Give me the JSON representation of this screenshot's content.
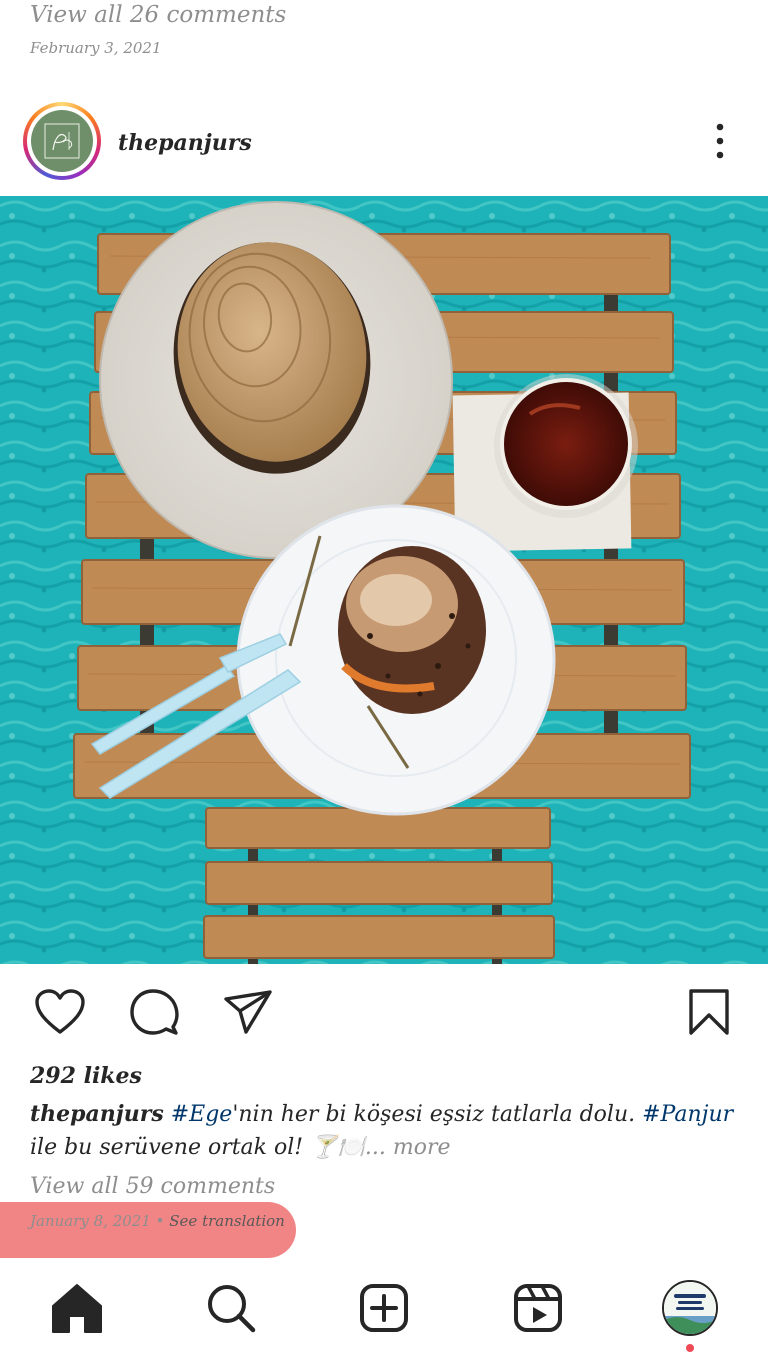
{
  "previous_post": {
    "view_comments": "View all 26 comments",
    "date": "February 3, 2021"
  },
  "post": {
    "username": "thepanjurs",
    "likes": "292 likes",
    "caption": {
      "user": "thepanjurs",
      "tag1": "#Ege",
      "text1": "'nin her bi köşesi eşsiz tatlarla dolu. ",
      "tag2": "#Panjur",
      "text2": " ile bu serüvene ortak ol! 🍸🍽️",
      "more": "... more"
    },
    "view_comments": "View all 59 comments",
    "date": "January 8, 2021",
    "separator": " • ",
    "translate": "See translation"
  },
  "nav": [
    "home-icon",
    "search-icon",
    "add-post-icon",
    "reels-icon",
    "profile-avatar"
  ],
  "colors": {
    "pool": "#1fb5b8",
    "wood": "#c08a55",
    "highlight": "#f07a7a",
    "notification": "#ed4956"
  }
}
